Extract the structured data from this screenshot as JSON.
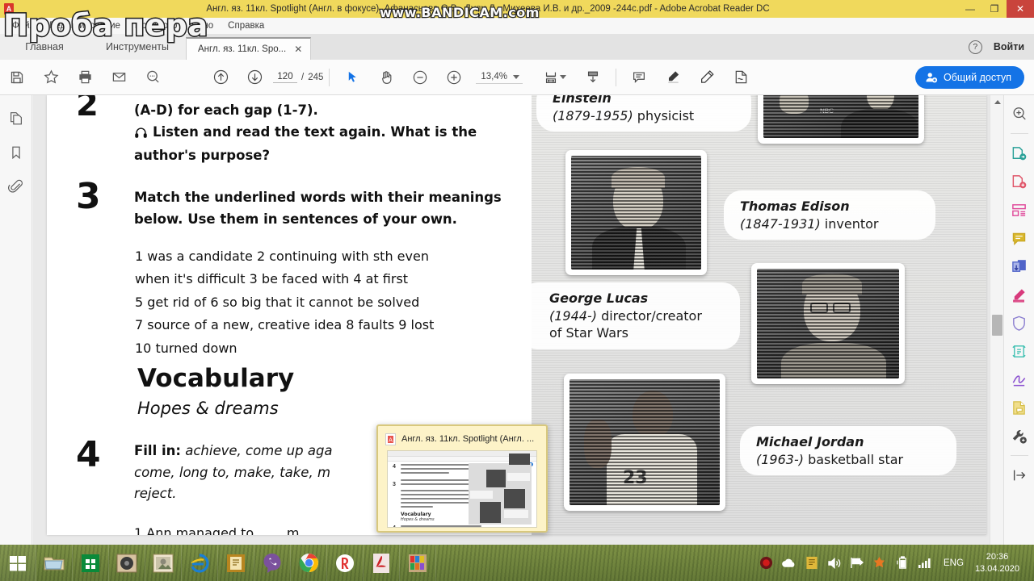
{
  "window": {
    "title": "Англ. яз. 11кл. Spotlight (Англ. в фокусе)_Афанасьева О.В., Дули Д., Михеева И.В. и др._2009 -244с.pdf - Adobe Acrobat Reader DC",
    "minimize_label": "—",
    "restore_label": "❐",
    "close_label": "✕"
  },
  "overlays": {
    "watermark_left": "Проба пера",
    "watermark_recorder": "www.BANDICAM.com"
  },
  "menu": {
    "items": [
      "Файл",
      "Редактирование",
      "Просмотр",
      "Окно",
      "Справка"
    ]
  },
  "main_tabs": {
    "home": "Главная",
    "tools": "Инструменты",
    "doc_tab": "Англ. яз. 11кл. Spo...",
    "doc_tab_close": "✕",
    "help_icon": "?",
    "sign_in": "Войти"
  },
  "toolbar": {
    "save_icon": "save-icon",
    "star_icon": "star-icon",
    "print_icon": "print-icon",
    "email_icon": "email-icon",
    "search_icon": "search-icon",
    "prev_page_icon": "arrow-up-circle-icon",
    "next_page_icon": "arrow-down-circle-icon",
    "page_current": "120",
    "page_separator": "/",
    "page_total": "245",
    "select_tool_icon": "cursor-icon",
    "hand_tool_icon": "hand-icon",
    "zoom_out_icon": "minus-circle-icon",
    "zoom_in_icon": "plus-circle-icon",
    "zoom_value": "13,4%",
    "fit_page_icon": "fit-page-icon",
    "scroll_mode_icon": "scroll-mode-icon",
    "comment_icon": "comment-icon",
    "highlight_icon": "highlighter-icon",
    "draw_icon": "draw-icon",
    "fill_sign_icon": "fill-and-sign-icon",
    "share_label": "Общий доступ"
  },
  "left_rail": {
    "items": [
      {
        "icon": "page-thumbnails-icon"
      },
      {
        "icon": "bookmark-icon"
      },
      {
        "icon": "attachment-icon"
      }
    ]
  },
  "right_rail": {
    "items": [
      {
        "icon": "search-document-icon",
        "color": "#5a5a5a"
      },
      {
        "icon": "export-pdf-icon",
        "color": "#2aa198"
      },
      {
        "icon": "create-pdf-icon",
        "color": "#e0566a"
      },
      {
        "icon": "organize-pages-icon",
        "color": "#e0499a"
      },
      {
        "icon": "comment-icon",
        "color": "#d9b72b"
      },
      {
        "icon": "combine-files-icon",
        "color": "#4f63c8"
      },
      {
        "icon": "highlighter-icon",
        "color": "#d83a7c"
      },
      {
        "icon": "protect-icon",
        "color": "#8c7fd0"
      },
      {
        "icon": "optimize-pdf-icon",
        "color": "#3bbfb0"
      },
      {
        "icon": "fill-and-sign-icon",
        "color": "#8a4fd0"
      },
      {
        "icon": "stamp-icon",
        "color": "#e0c33a"
      },
      {
        "icon": "more-tools-icon",
        "color": "#4a4a4a"
      },
      {
        "icon": "collapse-panel-icon",
        "color": "#4a4a4a"
      }
    ]
  },
  "document": {
    "ex2": {
      "number": "2",
      "line1": "(A-D) for each gap (1-7).",
      "headphone_icon": "headphones-icon",
      "line2": "Listen and read the text again. What is the",
      "line3": "author's purpose?"
    },
    "ex3": {
      "number": "3",
      "line1": "Match the underlined words with their meanings",
      "line2": "below. Use them in sentences of your own.",
      "items": [
        {
          "n": "1",
          "t": "was a candidate"
        },
        {
          "n": "2",
          "t": "continuing with sth even"
        },
        {
          "n": "",
          "t": "when it's difficult"
        },
        {
          "n": "3",
          "t": "be faced with"
        },
        {
          "n": "4",
          "t": "at first"
        },
        {
          "n": "5",
          "t": "get rid of"
        },
        {
          "n": "6",
          "t": "so big that it cannot be solved"
        },
        {
          "n": "7",
          "t": "source of a new, creative idea"
        },
        {
          "n": "8",
          "t": "faults"
        },
        {
          "n": "9",
          "t": "lost"
        },
        {
          "n": "10",
          "t": "turned down"
        }
      ],
      "line_a": "1 was a candidate  2 continuing with sth even",
      "line_b": "when it's difficult  3 be faced with  4 at first",
      "line_c": "5 get rid of  6 so big that it cannot be solved",
      "line_d": "7 source of a new, creative idea  8 faults  9 lost",
      "line_e": "10 turned down"
    },
    "vocabulary": {
      "heading": "Vocabulary",
      "subheading": "Hopes & dreams"
    },
    "ex4": {
      "number": "4",
      "lead": "Fill in:",
      "line1_italic": "achieve, come up aga",
      "line2_italic": "come, long to, make, take, m",
      "line3_italic": "reject.",
      "q1": "1   Ann  managed  to  ......  m"
    },
    "people": [
      {
        "name": "Einstein",
        "dates": "(1879-1955)",
        "role": "physicist"
      },
      {
        "name": "Thomas Edison",
        "dates": "(1847-1931)",
        "role": "inventor"
      },
      {
        "name": "George Lucas",
        "dates": "(1944-)",
        "role": "director/creator",
        "role2": "of Star Wars"
      },
      {
        "name": "Michael Jordan",
        "dates": "(1963-)",
        "role": "basketball star"
      }
    ],
    "jersey_number": "23",
    "nbc_label": "NBC"
  },
  "thumbnail_popup": {
    "title": "Англ. яз. 11кл. Spotlight (Англ. ...",
    "app_icon": "acrobat-icon",
    "mini": {
      "num_a": "4",
      "num_b": "3",
      "num_c": "4",
      "vocab": "Vocabulary",
      "vocab_sub": "Hopes & dreams"
    }
  },
  "taskbar": {
    "items": [
      {
        "icon": "windows-start-icon"
      },
      {
        "icon": "file-explorer-icon"
      },
      {
        "icon": "windows-store-icon"
      },
      {
        "icon": "media-player-icon"
      },
      {
        "icon": "photo-viewer-icon"
      },
      {
        "icon": "internet-explorer-icon"
      },
      {
        "icon": "notes-icon"
      },
      {
        "icon": "viber-icon"
      },
      {
        "icon": "chrome-icon"
      },
      {
        "icon": "yandex-icon"
      },
      {
        "icon": "acrobat-reader-icon"
      },
      {
        "icon": "app-colored-icon"
      }
    ],
    "tray": [
      {
        "icon": "record-icon"
      },
      {
        "icon": "cloud-icon"
      },
      {
        "icon": "notepad-tray-icon"
      },
      {
        "icon": "volume-icon"
      },
      {
        "icon": "flag-icon"
      },
      {
        "icon": "orange-app-icon"
      },
      {
        "icon": "battery-icon"
      },
      {
        "icon": "signal-icon"
      }
    ],
    "language": "ENG",
    "time": "20:36",
    "date": "13.04.2020"
  }
}
